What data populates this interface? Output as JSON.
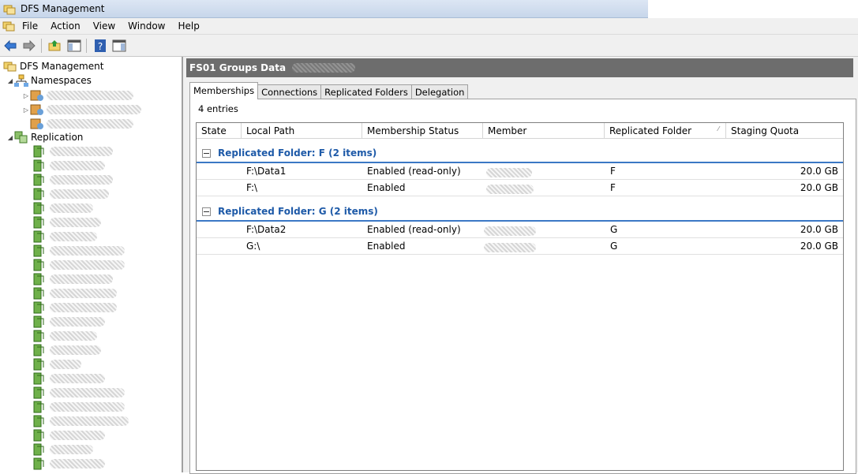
{
  "window": {
    "title": "DFS Management"
  },
  "menu": [
    "File",
    "Action",
    "View",
    "Window",
    "Help"
  ],
  "toolbar": {
    "buttons": [
      "back-arrow-icon",
      "forward-arrow-icon",
      "up-folder-icon",
      "show-hide-console-tree-icon",
      "help-icon",
      "show-hide-action-pane-icon"
    ]
  },
  "tree": {
    "root": "DFS Management",
    "namespaces_label": "Namespaces",
    "replication_label": "Replication"
  },
  "right": {
    "header_title": "FS01 Groups Data",
    "tabs": [
      "Memberships",
      "Connections",
      "Replicated Folders",
      "Delegation"
    ],
    "active_tab": "Memberships",
    "entries": "4 entries",
    "columns": [
      "State",
      "Local Path",
      "Membership Status",
      "Member",
      "Replicated Folder",
      "Staging Quota"
    ],
    "sorted_column": "Replicated Folder",
    "groups": [
      {
        "label": "Replicated Folder: F (2 items)",
        "rows": [
          {
            "state": "",
            "local_path": "F:\\Data1",
            "status": "Enabled (read-only)",
            "member": "",
            "folder": "F",
            "quota": "20.0 GB"
          },
          {
            "state": "",
            "local_path": "F:\\",
            "status": "Enabled",
            "member": "",
            "folder": "F",
            "quota": "20.0 GB"
          }
        ]
      },
      {
        "label": "Replicated Folder: G (2 items)",
        "rows": [
          {
            "state": "",
            "local_path": "F:\\Data2",
            "status": "Enabled (read-only)",
            "member": "",
            "folder": "G",
            "quota": "20.0 GB"
          },
          {
            "state": "",
            "local_path": "G:\\",
            "status": "Enabled",
            "member": "",
            "folder": "G",
            "quota": "20.0 GB"
          }
        ]
      }
    ]
  },
  "colors": {
    "group_text": "#1e5aa8",
    "group_line": "#3b78c5",
    "header_bg": "#6d6d6d"
  }
}
